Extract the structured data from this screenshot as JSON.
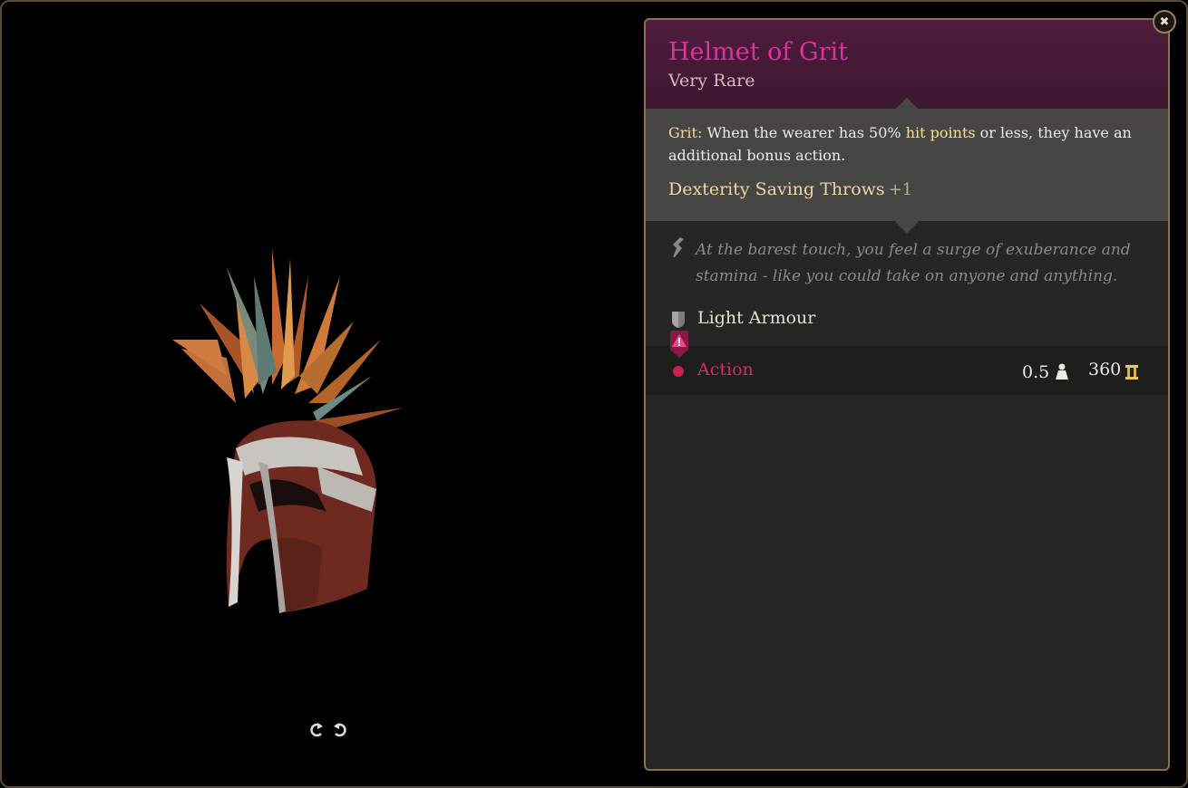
{
  "item": {
    "name": "Helmet of Grit",
    "rarity": "Very Rare",
    "grit_label": "Grit:",
    "grit_text_1": " When the wearer has 50% ",
    "grit_highlight": "hit points",
    "grit_text_2": " or less, they have an additional bonus action.",
    "stat_name": "Dexterity Saving Throws",
    "stat_value": "+1",
    "flavor": "At the barest touch, you feel a surge of exuberance and stamina - like you could take on anyone and anything.",
    "armour_type": "Light Armour",
    "action_label": "Action",
    "weight": "0.5",
    "price": "360"
  },
  "icons": {
    "close": "close-icon",
    "rotate_left": "rotate-left-icon",
    "rotate_right": "rotate-right-icon",
    "quill": "quill-icon",
    "armour": "armour-icon",
    "warning": "warning-icon",
    "weight": "weight-icon",
    "gold": "gold-icon"
  },
  "colors": {
    "title": "#d9359c",
    "header_bg": "#4f1c3d",
    "highlight": "#f4e48a",
    "action": "#d9286a",
    "border": "#8a7250"
  }
}
